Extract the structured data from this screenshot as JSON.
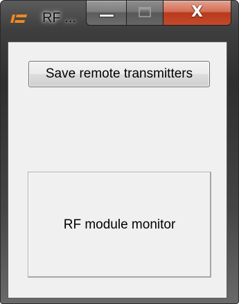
{
  "window": {
    "title": "RF ...",
    "app_icon": "rf-app-icon",
    "caption_buttons": {
      "minimize_icon": "minimize-icon",
      "maximize_icon": "maximize-icon",
      "close_icon": "close-icon",
      "close_glyph": "X",
      "maximize_enabled": false
    }
  },
  "content": {
    "save_button_label": "Save remote transmitters",
    "monitor_button_label": "RF module monitor"
  },
  "colors": {
    "close_button": "#c4492b",
    "client_background": "#f0f0f0"
  }
}
